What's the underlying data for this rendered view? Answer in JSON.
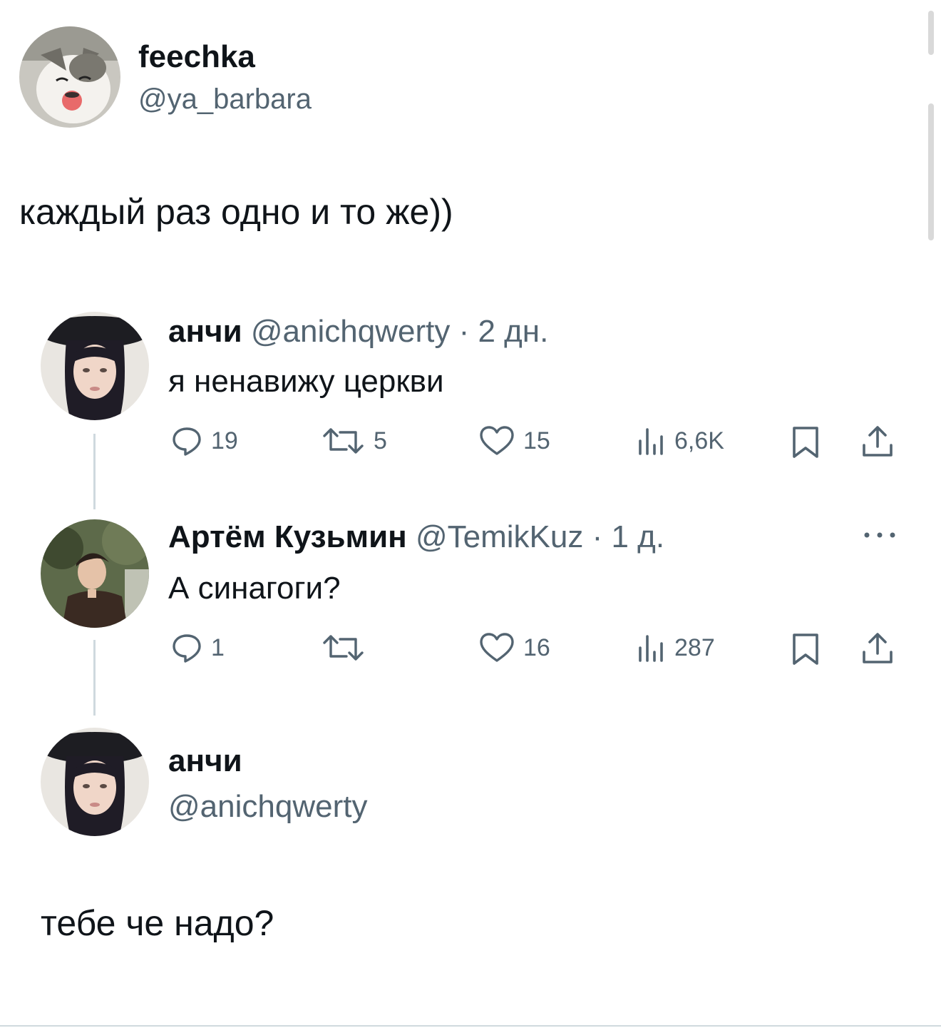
{
  "colors": {
    "text": "#0f1419",
    "muted": "#536471",
    "thread_line": "#cfd9de",
    "background": "#ffffff"
  },
  "main_post": {
    "display_name": "feechka",
    "handle": "@ya_barbara",
    "text": "каждый раз одно и то же))",
    "avatar_icon": "cat-avatar"
  },
  "quoted_thread": [
    {
      "display_name": "анчи",
      "handle": "@anichqwerty",
      "time": "· 2 дн.",
      "text": "я ненавижу церкви",
      "stats": {
        "replies": "19",
        "reposts": "5",
        "likes": "15",
        "views": "6,6K"
      }
    },
    {
      "display_name": "Артём Кузьмин",
      "handle": "@TemikKuz",
      "time": "· 1 д.",
      "text": "А синагоги?",
      "more_icon": "more-dots-icon",
      "stats": {
        "replies": "1",
        "reposts": "",
        "likes": "16",
        "views": "287"
      }
    }
  ],
  "reply_author": {
    "display_name": "анчи",
    "handle": "@anichqwerty"
  },
  "reply_text": "тебе че надо?",
  "icons": [
    "reply-icon",
    "repost-icon",
    "like-icon",
    "views-icon",
    "bookmark-icon",
    "share-icon"
  ]
}
